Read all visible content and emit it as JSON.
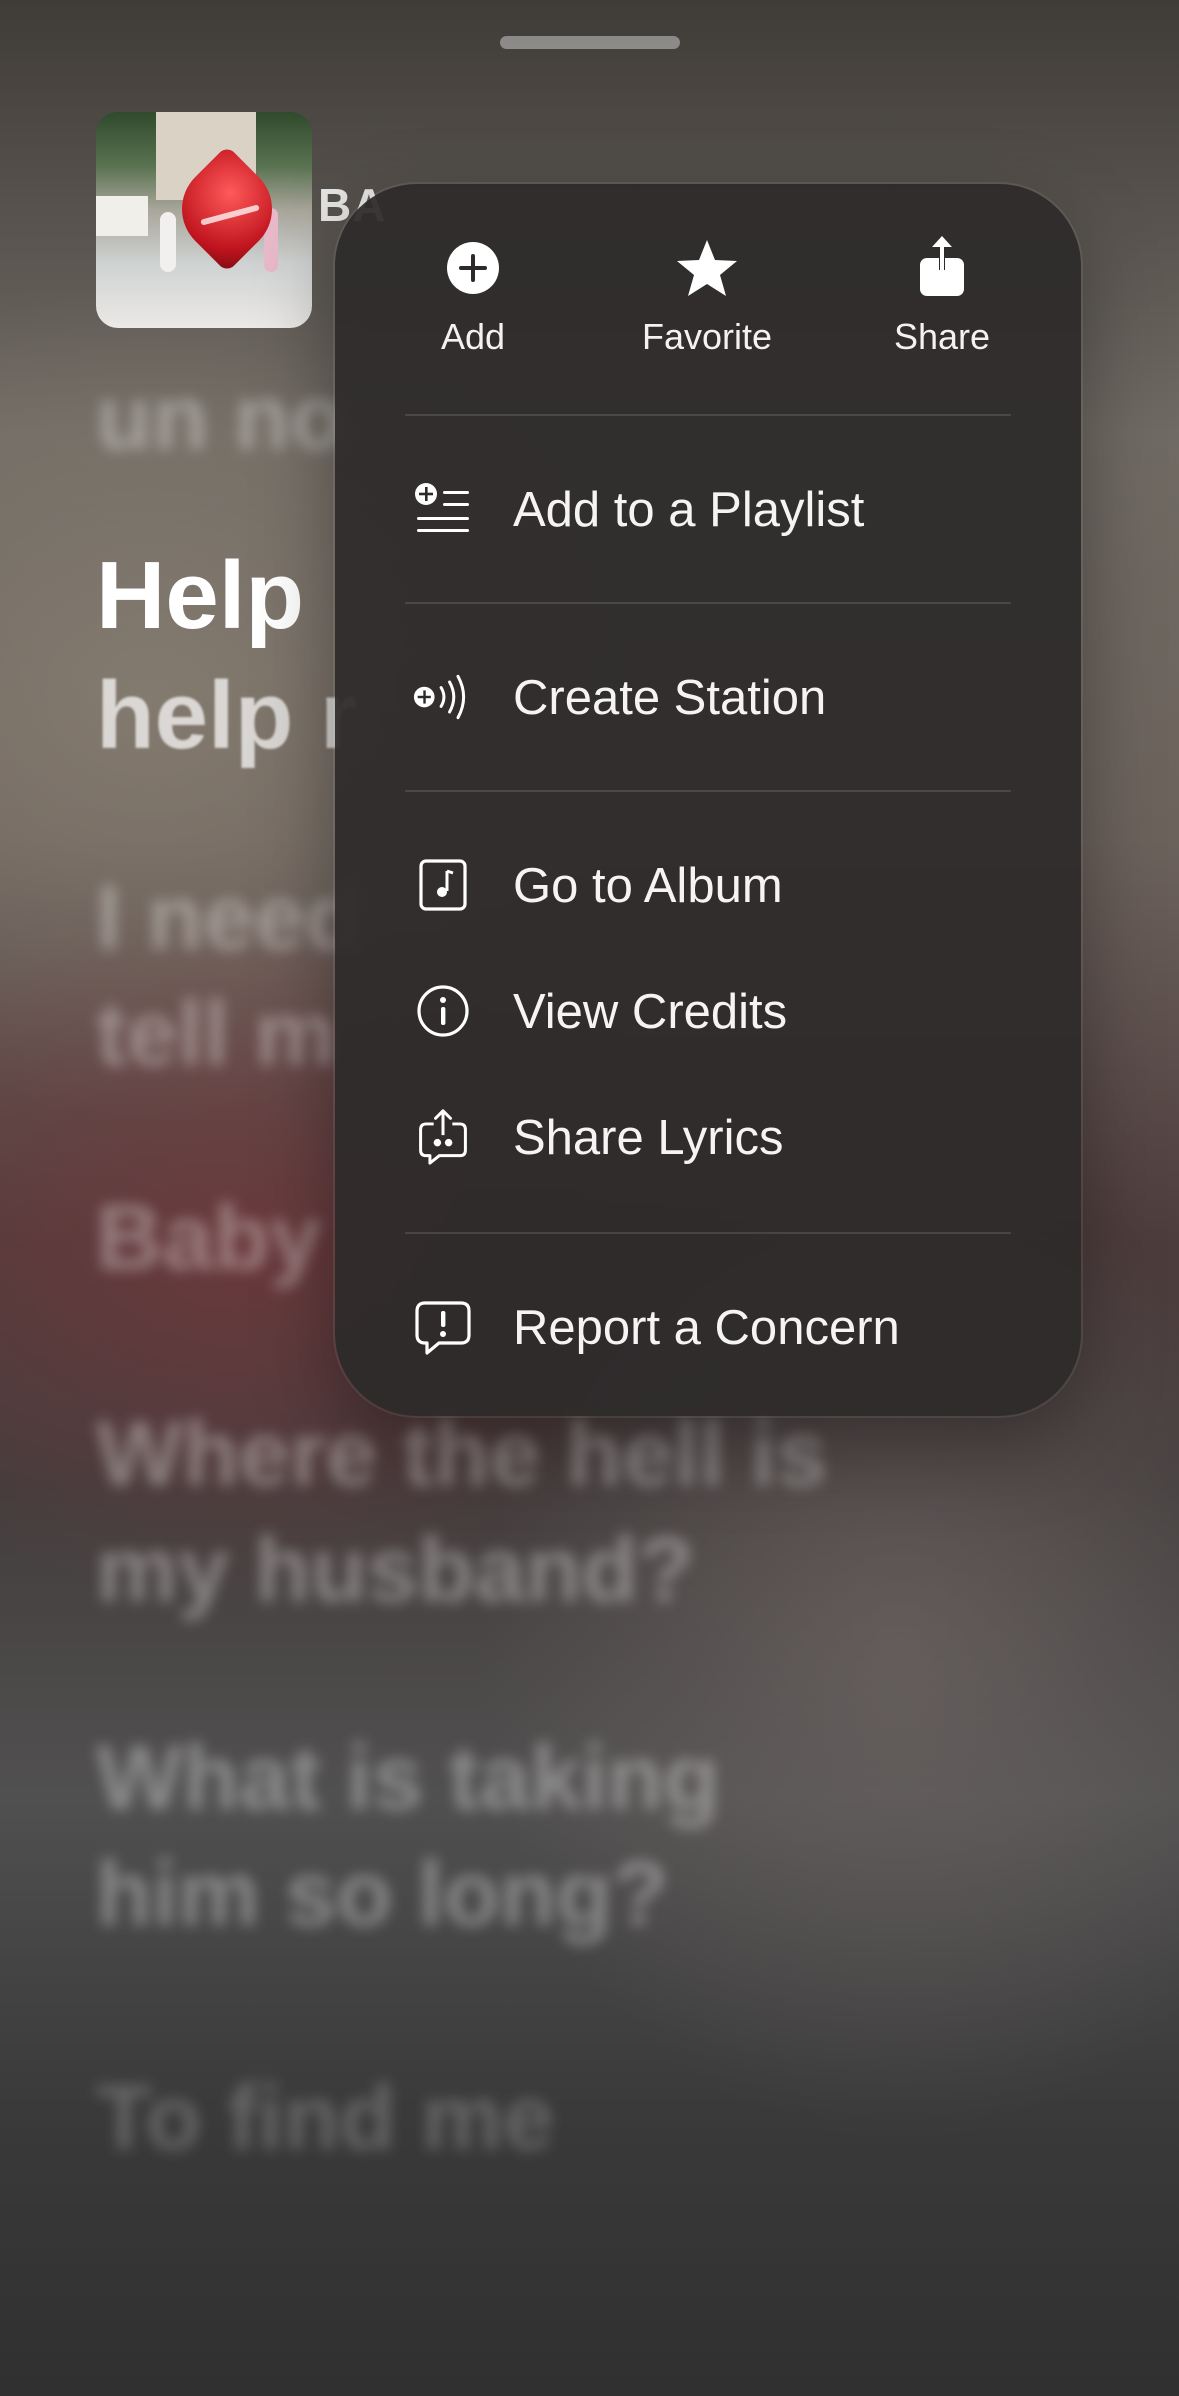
{
  "now_playing": {
    "artist_peek": "BA",
    "artwork_icon": "album-artwork"
  },
  "lyrics": {
    "prev_line": "un no",
    "current_line": "Help",
    "current_line_cont": "help r",
    "upcoming": [
      "I need",
      "tell m",
      "Baby",
      "Where the hell is",
      "my husband?",
      "What is taking",
      "him so long?",
      "To find me"
    ]
  },
  "menu": {
    "quick_actions": [
      {
        "label": "Add",
        "icon": "plus-circle-icon"
      },
      {
        "label": "Favorite",
        "icon": "star-icon"
      },
      {
        "label": "Share",
        "icon": "share-icon"
      }
    ],
    "items": [
      {
        "label": "Add to a Playlist",
        "icon": "add-to-playlist-icon"
      },
      {
        "label": "Create Station",
        "icon": "create-station-icon"
      },
      {
        "label": "Go to Album",
        "icon": "album-icon"
      },
      {
        "label": "View Credits",
        "icon": "info-icon"
      },
      {
        "label": "Share Lyrics",
        "icon": "share-lyrics-icon"
      },
      {
        "label": "Report a Concern",
        "icon": "report-icon"
      }
    ]
  }
}
